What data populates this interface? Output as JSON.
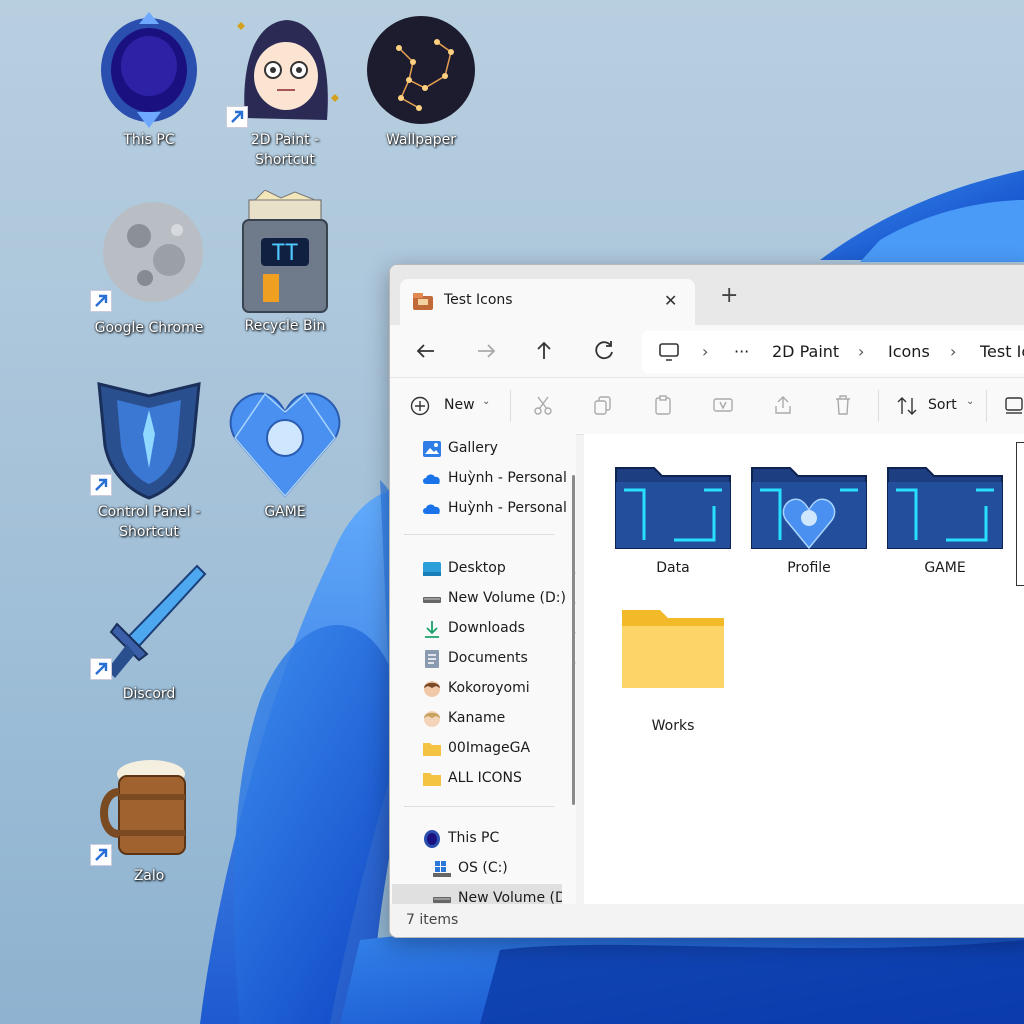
{
  "desktop": {
    "icons": [
      {
        "label": "This PC"
      },
      {
        "label": "2D Paint - Shortcut"
      },
      {
        "label": "Wallpaper"
      },
      {
        "label": "Google Chrome"
      },
      {
        "label": "Recycle Bin"
      },
      {
        "label": "Control Panel -"
      },
      {
        "label": "Shortcut"
      },
      {
        "label": "GAME"
      },
      {
        "label": "Discord"
      },
      {
        "label": "Zalo"
      }
    ]
  },
  "explorer": {
    "tab_title": "Test Icons",
    "breadcrumbs": [
      "2D Paint",
      "Icons",
      "Test Ic"
    ],
    "ellipsis": "···",
    "toolbar": {
      "new_label": "New",
      "sort_label": "Sort"
    },
    "nav": [
      {
        "label": "Gallery"
      },
      {
        "label": "Huỳnh - Personal"
      },
      {
        "label": "Huỳnh - Personal"
      },
      {
        "label": "Desktop"
      },
      {
        "label": "New Volume (D:)"
      },
      {
        "label": "Downloads"
      },
      {
        "label": "Documents"
      },
      {
        "label": "Kokoroyomi"
      },
      {
        "label": "Kaname"
      },
      {
        "label": "00ImageGA"
      },
      {
        "label": "ALL ICONS"
      },
      {
        "label": "This PC"
      },
      {
        "label": "OS (C:)"
      },
      {
        "label": "New Volume (D:)"
      }
    ],
    "items": [
      {
        "label": "Data"
      },
      {
        "label": "Profile"
      },
      {
        "label": "GAME"
      },
      {
        "label": "Works"
      }
    ],
    "status": "7 items"
  }
}
